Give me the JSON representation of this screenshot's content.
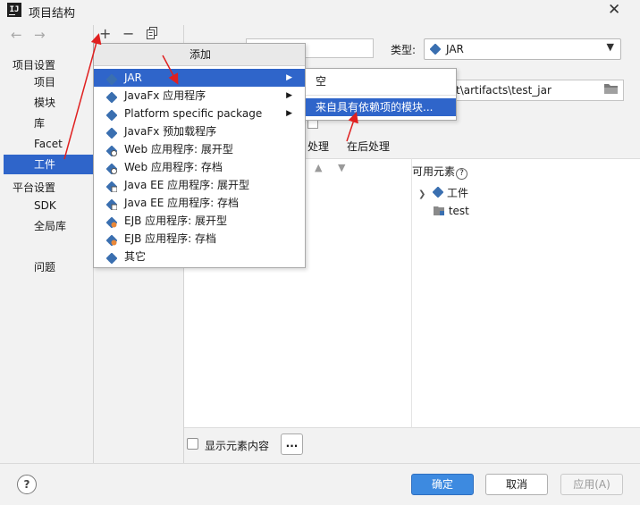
{
  "window": {
    "title": "项目结构"
  },
  "nav": {
    "project_settings": "项目设置",
    "items_top": [
      "项目",
      "模块",
      "库",
      "Facet",
      "工件"
    ],
    "platform_settings": "平台设置",
    "items_bottom": [
      "SDK",
      "全局库"
    ],
    "problems": "问题"
  },
  "toolbar": {
    "add": "+",
    "remove": "−"
  },
  "popup": {
    "header": "添加",
    "items": [
      {
        "label": "JAR",
        "icon": "jar-icon",
        "submenu": true
      },
      {
        "label": "JavaFx 应用程序",
        "icon": "javafx-icon",
        "submenu": true
      },
      {
        "label": "Platform specific package",
        "icon": "package-icon",
        "submenu": true
      },
      {
        "label": "JavaFx 预加载程序",
        "icon": "javafx-icon",
        "submenu": false
      },
      {
        "label": "Web 应用程序: 展开型",
        "icon": "web-icon",
        "submenu": false
      },
      {
        "label": "Web 应用程序: 存档",
        "icon": "web-icon",
        "submenu": false
      },
      {
        "label": "Java EE 应用程序: 展开型",
        "icon": "javaee-icon",
        "submenu": false
      },
      {
        "label": "Java EE 应用程序: 存档",
        "icon": "javaee-icon",
        "submenu": false
      },
      {
        "label": "EJB 应用程序: 展开型",
        "icon": "ejb-icon",
        "submenu": false
      },
      {
        "label": "EJB 应用程序: 存档",
        "icon": "ejb-icon",
        "submenu": false
      },
      {
        "label": "其它",
        "icon": "other-icon",
        "submenu": false
      }
    ]
  },
  "submenu": {
    "items": [
      "空",
      "来自具有依赖项的模块..."
    ]
  },
  "artifact": {
    "type_label": "类型:",
    "type_value": "JAR",
    "output_path": "t\\artifacts\\test_jar",
    "tab_pre": "处理",
    "tab_post": "在后处理",
    "available_label": "可用元素",
    "tree_artifacts": "工件",
    "tree_test": "test",
    "show_contents": "显示元素内容",
    "more": "..."
  },
  "buttons": {
    "ok": "确定",
    "cancel": "取消",
    "apply": "应用(A)",
    "help": "?"
  },
  "colors": {
    "selection": "#2f65ca",
    "primary_button": "#3d8ae0",
    "annotation": "#e02020",
    "jar_icon": "#3a6fb0"
  }
}
